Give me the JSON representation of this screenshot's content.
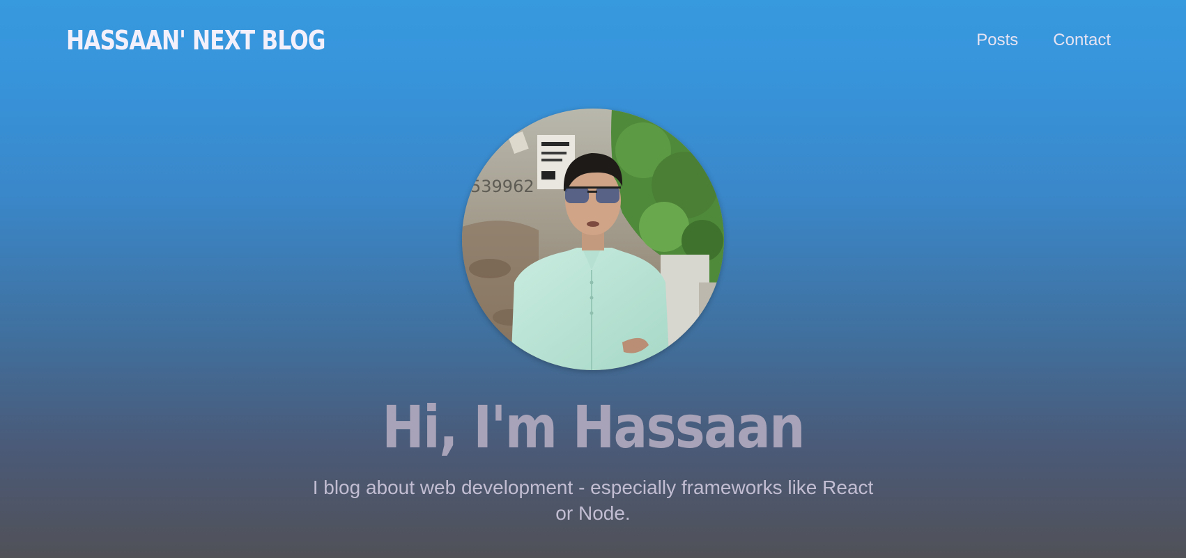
{
  "header": {
    "logo_text": "HASSAAN' NEXT BLOG",
    "nav": [
      {
        "label": "Posts"
      },
      {
        "label": "Contact"
      }
    ]
  },
  "hero": {
    "title": "Hi, I'm Hassaan",
    "description": "I blog about web development - especially frameworks like React or Node."
  },
  "colors": {
    "gradient_top": "#3799de",
    "gradient_bottom": "#515158",
    "logo": "#f3f0fb",
    "title": "#a8a3b8",
    "text": "#c2bdd2"
  }
}
